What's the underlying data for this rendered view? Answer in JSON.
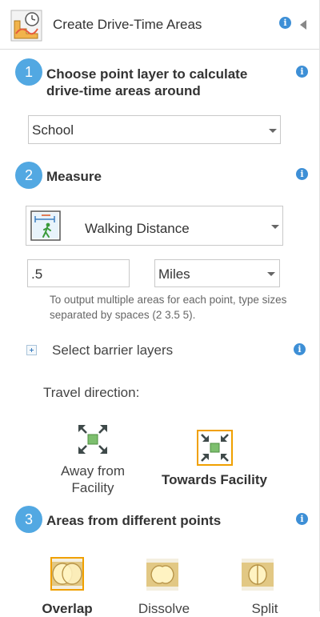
{
  "header": {
    "title": "Create Drive-Time Areas",
    "info_icon": "info-icon",
    "collapse_icon": "triangle-left-icon"
  },
  "step1": {
    "number": "1",
    "title_line1": "Choose point layer to calculate",
    "title_line2": "drive-time areas around",
    "layer_value": "School"
  },
  "step2": {
    "number": "2",
    "title": "Measure",
    "measure_value": "Walking Distance",
    "distance_value": ".5",
    "unit_value": "Miles",
    "hint_line1": "To output multiple areas for each point, type sizes",
    "hint_line2": "separated by spaces (2 3.5 5).",
    "barrier_label": "Select barrier layers",
    "travel_label": "Travel direction:",
    "away_line1": "Away from",
    "away_line2": "Facility",
    "towards_label": "Towards Facility"
  },
  "step3": {
    "number": "3",
    "title": "Areas from different points",
    "options": [
      "Overlap",
      "Dissolve",
      "Split"
    ]
  },
  "colors": {
    "accent": "#52a8e2",
    "selected_border": "#f0a000",
    "info": "#3d8fd6",
    "facility_green": "#7dbf6e"
  }
}
